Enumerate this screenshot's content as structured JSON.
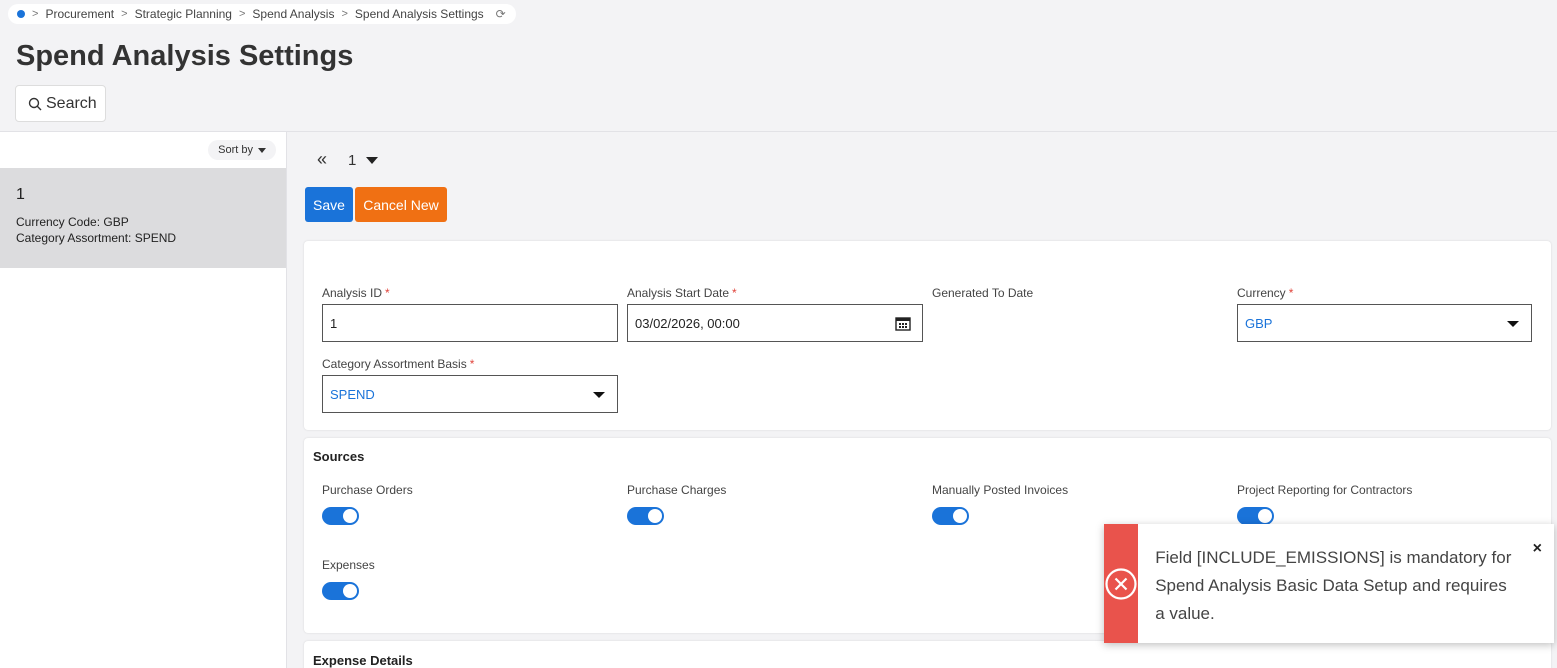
{
  "breadcrumb": {
    "items": [
      "Procurement",
      "Strategic Planning",
      "Spend Analysis",
      "Spend Analysis Settings"
    ]
  },
  "page": {
    "title": "Spend Analysis Settings"
  },
  "search": {
    "label": "Search"
  },
  "list": {
    "sort_label": "Sort by",
    "items": [
      {
        "title": "1",
        "currency_line": "Currency Code:  GBP",
        "category_line": "Category Assortment:  SPEND"
      }
    ]
  },
  "nav": {
    "first_icon": "«",
    "page": "1"
  },
  "toolbar": {
    "save_label": "Save",
    "cancel_label": "Cancel New"
  },
  "form": {
    "analysis_id": {
      "label": "Analysis ID",
      "value": "1"
    },
    "start_date": {
      "label": "Analysis Start Date",
      "value": "03/02/2026, 00:00"
    },
    "generated_to": {
      "label": "Generated To Date"
    },
    "currency": {
      "label": "Currency",
      "value": "GBP"
    },
    "category_basis": {
      "label": "Category Assortment Basis",
      "value": "SPEND"
    },
    "required_mark": "*"
  },
  "sources": {
    "title": "Sources",
    "toggles": [
      {
        "label": "Purchase Orders",
        "on": true
      },
      {
        "label": "Purchase Charges",
        "on": true
      },
      {
        "label": "Manually Posted Invoices",
        "on": true
      },
      {
        "label": "Project Reporting for Contractors",
        "on": true
      },
      {
        "label": "Expenses",
        "on": true
      }
    ]
  },
  "expense_details": {
    "title": "Expense Details"
  },
  "toast": {
    "message": "Field [INCLUDE_EMISSIONS] is mandatory for Spend Analysis Basic Data Setup and requires a value.",
    "close": "×"
  },
  "colors": {
    "accent": "#1a73d9",
    "cancel": "#f07013",
    "error": "#e9534c"
  }
}
